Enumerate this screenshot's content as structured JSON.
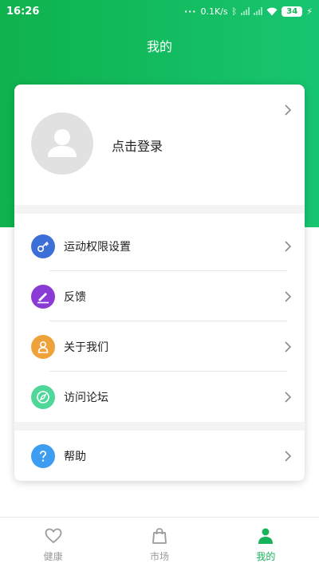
{
  "status_bar": {
    "time": "16:26",
    "network_speed": "0.1K/s",
    "battery": "34"
  },
  "header": {
    "title": "我的"
  },
  "profile": {
    "login_label": "点击登录"
  },
  "menu": {
    "items": [
      {
        "label": "运动权限设置",
        "icon": "key-icon",
        "color": "#3d6fd8"
      },
      {
        "label": "反馈",
        "icon": "pen-icon",
        "color": "#8a3bd6"
      },
      {
        "label": "关于我们",
        "icon": "person-icon",
        "color": "#f0a23a"
      },
      {
        "label": "访问论坛",
        "icon": "compass-icon",
        "color": "#4fd79a"
      },
      {
        "label": "帮助",
        "icon": "question-icon",
        "color": "#3d9df0"
      }
    ]
  },
  "bottom_nav": {
    "tabs": [
      {
        "label": "健康",
        "icon": "heart-icon",
        "active": false
      },
      {
        "label": "市场",
        "icon": "shopping-bag-icon",
        "active": false
      },
      {
        "label": "我的",
        "icon": "user-icon",
        "active": true
      }
    ]
  },
  "colors": {
    "brand_green": "#17b35a",
    "inactive_gray": "#9a9a9a"
  }
}
